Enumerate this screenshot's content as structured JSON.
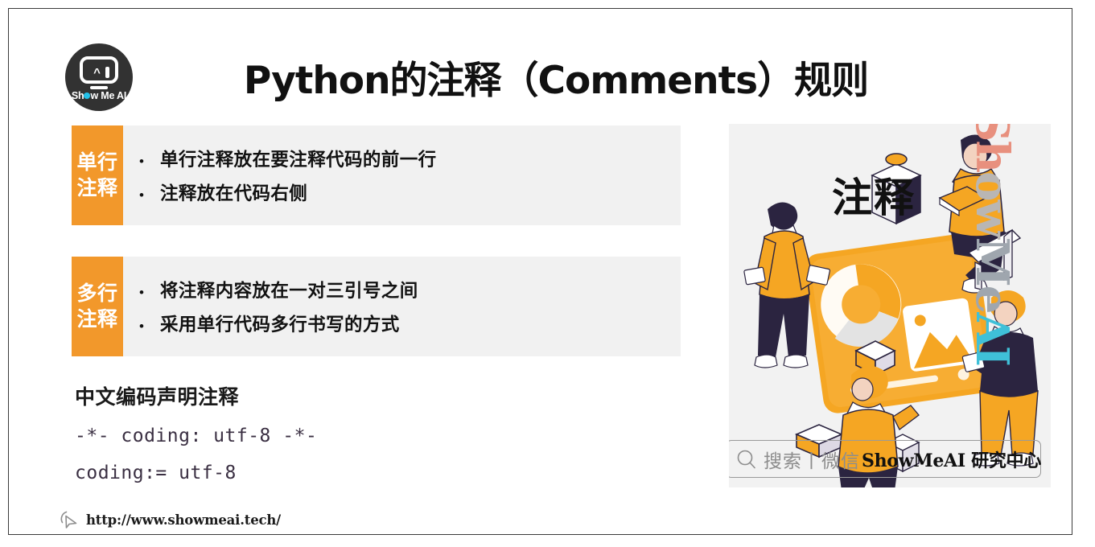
{
  "slide": {
    "title": "Python的注释（Comments）规则",
    "logo": {
      "name": "show-me-ai-logo",
      "text_before": "Sh",
      "text_after": "w Me AI",
      "eye_left": "^"
    }
  },
  "blocks": [
    {
      "tab_line_1": "单行",
      "tab_line_2": "注释",
      "bullet_marker": "•",
      "bullets": [
        "单行注释放在要注释代码的前一行",
        "注释放在代码右侧"
      ]
    },
    {
      "tab_line_1": "多行",
      "tab_line_2": "注释",
      "bullet_marker": "•",
      "bullets": [
        "将注释内容放在一对三引号之间",
        "采用单行代码多行书写的方式"
      ]
    }
  ],
  "code_section": {
    "heading": "中文编码声明注释",
    "line_1": "-*- coding: utf-8 -*-",
    "line_2": "coding:= utf-8"
  },
  "footer": {
    "url": "http://www.showmeai.tech/",
    "icon": "cursor-click-icon"
  },
  "panel": {
    "title": "注释",
    "vertical_brand": {
      "part_1": "Sh",
      "part_2": "ow",
      "part_3": "Me",
      "part_4": "AI"
    },
    "search": {
      "icon": "search-icon",
      "label": "搜索丨微信",
      "brand": "ShowMeAI 研究中心"
    },
    "illustration": "isometric-team-with-device-illustration"
  },
  "colors": {
    "accent_orange": "#f2982b",
    "block_background": "#f1f1f1",
    "panel_background": "#f2f2f2",
    "code_text": "#3a2f42",
    "logo_background": "#323232",
    "logo_dot": "#23c0e8",
    "border": "#3b3b3b"
  }
}
